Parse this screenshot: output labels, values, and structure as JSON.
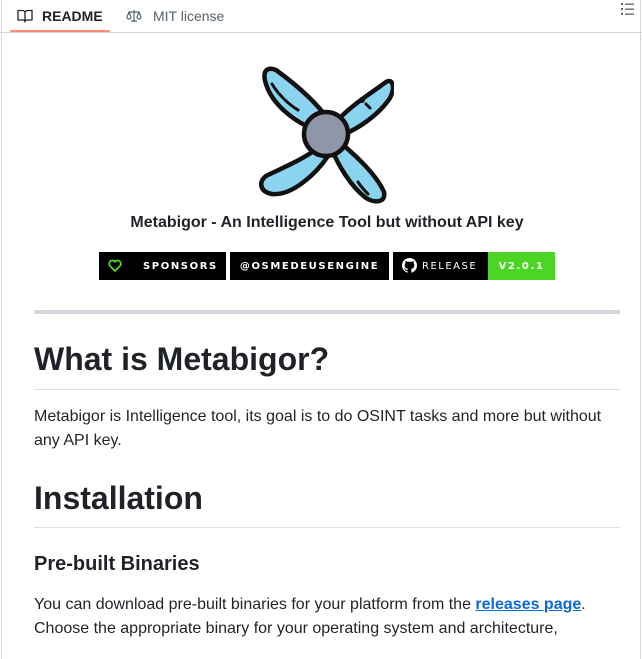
{
  "tabs": [
    {
      "label": "README",
      "icon": "book-icon",
      "active": true
    },
    {
      "label": "MIT license",
      "icon": "scale-icon",
      "active": false
    }
  ],
  "toolbar": {
    "outline_icon": "list-icon"
  },
  "readme": {
    "logo_icon": "metabigor-fan-logo",
    "tagline": "Metabigor - An Intelligence Tool but without API key",
    "badges": {
      "sponsors": "SPONSORS",
      "osmedeus": "@OSMEDEUSENGINE",
      "release_label": "RELEASE",
      "release_version": "V2.0.1"
    },
    "heading_what": "What is Metabigor?",
    "what_text": "Metabigor is Intelligence tool, its goal is to do OSINT tasks and more but without any API key.",
    "heading_install": "Installation",
    "heading_prebuilt": "Pre-built Binaries",
    "download_text_before": "You can download pre-built binaries for your platform from the ",
    "download_link": "releases page",
    "download_text_after": ". Choose the appropriate binary for your operating system and architecture,"
  },
  "colors": {
    "accent_underline": "#fd8c73",
    "link": "#0969da",
    "version_badge": "#4bd625",
    "logo_fill": "#8ad4f0",
    "logo_center": "#8e96a8"
  }
}
